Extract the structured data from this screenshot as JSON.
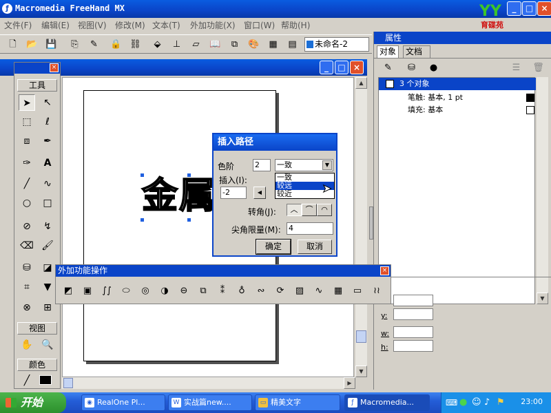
{
  "app": {
    "title": "Macromedia FreeHand MX",
    "logo_text": "育碟苑",
    "logo_mark": "YY"
  },
  "menu": [
    "文件(F)",
    "编辑(E)",
    "视图(V)",
    "修改(M)",
    "文本(T)",
    "外加功能(X)",
    "窗口(W)",
    "帮助(H)"
  ],
  "toolbar": {
    "document_name": "未命名-2"
  },
  "tools_panel": {
    "title": "工具",
    "view_title": "视图",
    "color_title": "颜色"
  },
  "canvas": {
    "art_text": "金属"
  },
  "properties": {
    "title": "属性",
    "tabs": [
      "对象",
      "文档"
    ],
    "rows": [
      {
        "label": "3 个对象"
      },
      {
        "label": "笔触: 基本, 1 pt"
      },
      {
        "label": "填充: 基本"
      }
    ],
    "fields": [
      "y:",
      "w:",
      "h:"
    ]
  },
  "dialog": {
    "title": "插入路径",
    "steps_label": "色阶",
    "steps_value": "2",
    "mode_selected": "一致",
    "options": [
      "一致",
      "较远",
      "较近"
    ],
    "insert_label": "插入(I):",
    "insert_value": "-2",
    "join_label": "转角(J):",
    "miter_label": "尖角限量(M):",
    "miter_value": "4",
    "ok": "确定",
    "cancel": "取消"
  },
  "xtra": {
    "title": "外加功能操作"
  },
  "taskbar": {
    "start": "开始",
    "tasks": [
      "RealOne Pl...",
      "实战篇new....",
      "精美文字",
      "Macromedia..."
    ],
    "clock": "23:00"
  }
}
